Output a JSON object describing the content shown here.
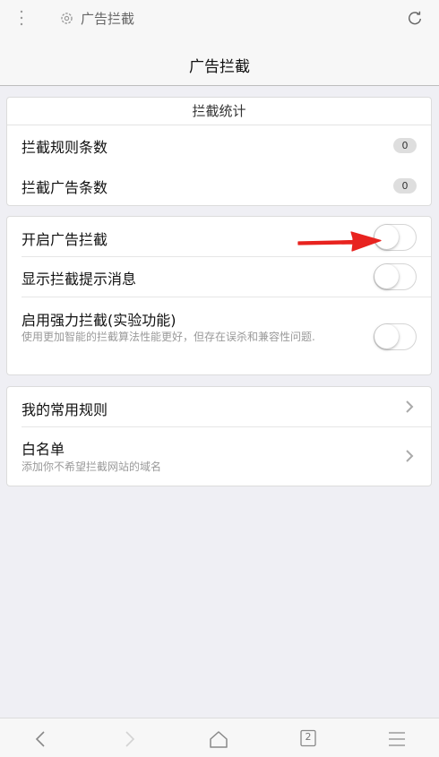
{
  "topbar": {
    "tab_title": "广告拦截",
    "icons": [
      "more-vertical-icon",
      "gear-icon",
      "reload-icon"
    ]
  },
  "header": {
    "title": "广告拦截"
  },
  "stats": {
    "heading": "拦截统计",
    "rows": [
      {
        "label": "拦截规则条数",
        "count": "0"
      },
      {
        "label": "拦截广告条数",
        "count": "0"
      }
    ]
  },
  "settings": {
    "rows": [
      {
        "label": "开启广告拦截",
        "enabled": false
      },
      {
        "label": "显示拦截提示消息",
        "enabled": false
      },
      {
        "label": "启用强力拦截(实验功能)",
        "desc": "使用更加智能的拦截算法性能更好，但存在误杀和兼容性问题.",
        "enabled": false
      }
    ]
  },
  "rules": {
    "rows": [
      {
        "label": "我的常用规则"
      },
      {
        "label": "白名单",
        "desc": "添加你不希望拦截网站的域名"
      }
    ]
  },
  "annotation": {
    "color": "#e8231f"
  },
  "bottombar": {
    "tab_count": "2",
    "icons": [
      "back-icon",
      "forward-icon",
      "home-icon",
      "tabs-icon",
      "menu-icon"
    ]
  },
  "colors": {
    "background": "#efeff4",
    "card": "#ffffff",
    "badge": "#dedede"
  }
}
